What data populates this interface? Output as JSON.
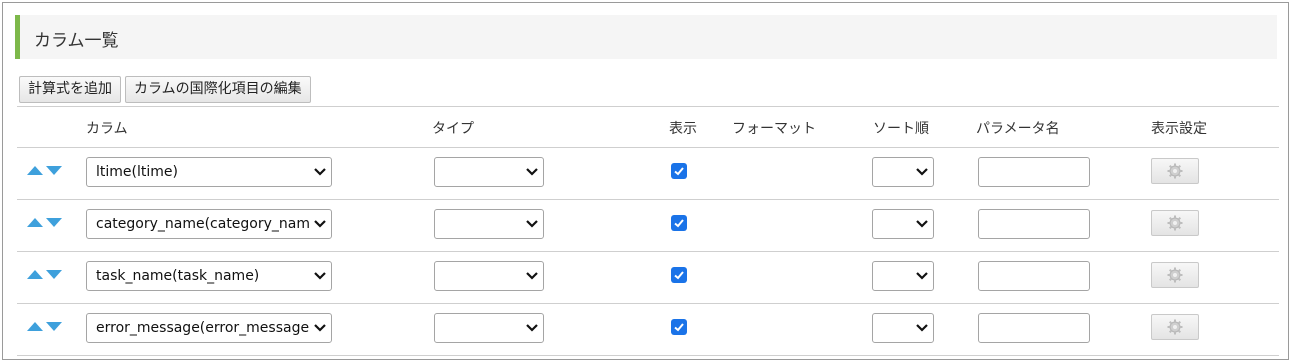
{
  "section": {
    "title": "カラム一覧"
  },
  "toolbar": {
    "add_formula": "計算式を追加",
    "edit_i18n": "カラムの国際化項目の編集"
  },
  "table": {
    "headers": {
      "column": "カラム",
      "type": "タイプ",
      "display": "表示",
      "format": "フォーマット",
      "sort": "ソート順",
      "param": "パラメータ名",
      "settings": "表示設定"
    },
    "rows": [
      {
        "column": "ltime(ltime)",
        "type": "",
        "display": true,
        "sort": "",
        "param": ""
      },
      {
        "column": "category_name(category_name)",
        "type": "",
        "display": true,
        "sort": "",
        "param": ""
      },
      {
        "column": "task_name(task_name)",
        "type": "",
        "display": true,
        "sort": "",
        "param": ""
      },
      {
        "column": "error_message(error_message)",
        "type": "",
        "display": true,
        "sort": "",
        "param": ""
      }
    ]
  },
  "colors": {
    "accent": "#7db84a",
    "arrow": "#3ea0dc",
    "checkbox": "#1a73e8"
  },
  "icons": {
    "move_up": "triangle-up-icon",
    "move_down": "triangle-down-icon",
    "settings": "gear-icon"
  }
}
